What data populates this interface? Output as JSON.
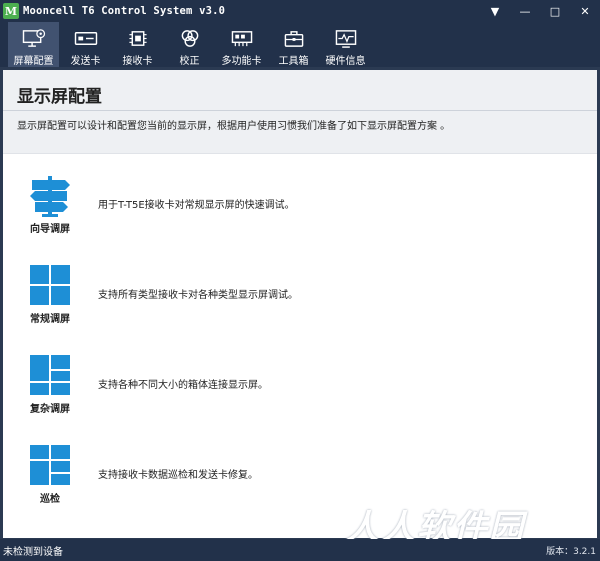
{
  "window": {
    "title": "Mooncell T6 Control System v3.0",
    "logo_letter": "M",
    "controls": [
      "▼",
      "—",
      "□",
      "✕"
    ]
  },
  "toolbar": {
    "items": [
      {
        "label": "屏幕配置",
        "icon": "monitor-gear-icon",
        "active": true
      },
      {
        "label": "发送卡",
        "icon": "sender-card-icon",
        "active": false
      },
      {
        "label": "接收卡",
        "icon": "chip-icon",
        "active": false
      },
      {
        "label": "校正",
        "icon": "color-circles-icon",
        "active": false
      },
      {
        "label": "多功能卡",
        "icon": "multifunction-card-icon",
        "active": false
      },
      {
        "label": "工具箱",
        "icon": "toolbox-icon",
        "active": false
      },
      {
        "label": "硬件信息",
        "icon": "waveform-monitor-icon",
        "active": false
      }
    ]
  },
  "page": {
    "title": "显示屏配置",
    "description": "显示屏配置可以设计和配置您当前的显示屏，根据用户使用习惯我们准备了如下显示屏配置方案 。"
  },
  "options": [
    {
      "label": "向导调屏",
      "desc": "用于T-T5E接收卡对常规显示屏的快速调试。",
      "icon": "signpost-icon"
    },
    {
      "label": "常规调屏",
      "desc": "支持所有类型接收卡对各种类型显示屏调试。",
      "icon": "grid-four-icon"
    },
    {
      "label": "复杂调屏",
      "desc": "支持各种不同大小的箱体连接显示屏。",
      "icon": "grid-complex-icon"
    },
    {
      "label": "巡检",
      "desc": "支持接收卡数据巡检和发送卡修复。",
      "icon": "grid-inspect-icon"
    }
  ],
  "watermark": "人人软件园",
  "status": {
    "text": "未检测到设备",
    "version": "版本：3.2.1"
  },
  "colors": {
    "titlebar": "#22314a",
    "toolbar_active": "#415270",
    "icon_blue": "#1e8fd6",
    "header_panel": "#eef0f3"
  }
}
